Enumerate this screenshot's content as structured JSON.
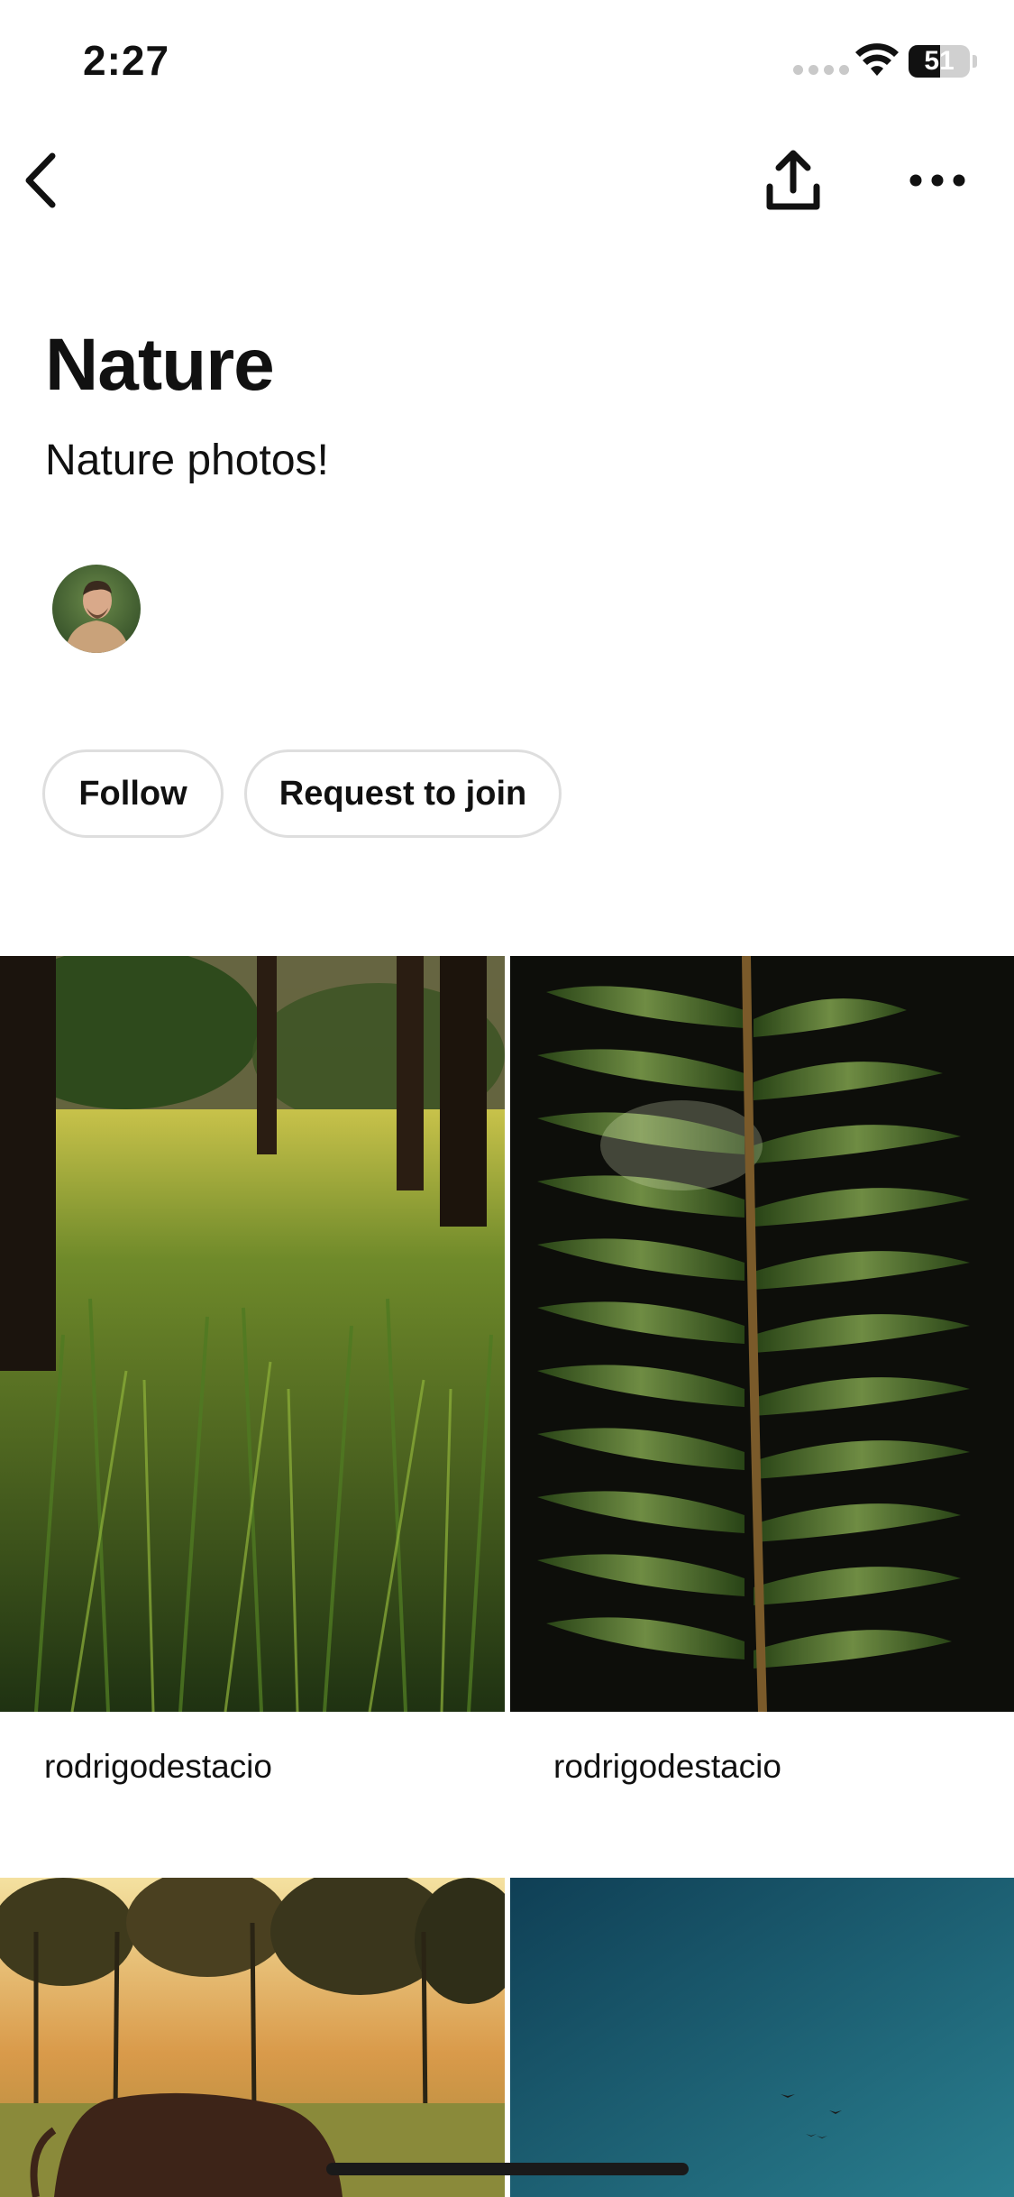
{
  "status_bar": {
    "time": "2:27",
    "battery_level": "51",
    "battery_fraction": 0.51,
    "icons": [
      "signal-icon",
      "wifi-icon",
      "battery-icon"
    ]
  },
  "nav": {
    "icons": [
      "chevron-left-icon",
      "share-icon",
      "more-icon"
    ]
  },
  "board": {
    "title": "Nature",
    "description": "Nature photos!",
    "buttons": {
      "follow": "Follow",
      "request_to_join": "Request to join"
    }
  },
  "pins": [
    {
      "author": "rodrigodestacio",
      "image": "sunlit grass under trees"
    },
    {
      "author": "rodrigodestacio",
      "image": "fern leaf in dark"
    },
    {
      "author": "",
      "image": "cow at sunset field"
    },
    {
      "author": "",
      "image": "blue sky with birds"
    }
  ],
  "colors": {
    "text": "#111111",
    "pill_border": "#dedede",
    "background": "#ffffff"
  }
}
